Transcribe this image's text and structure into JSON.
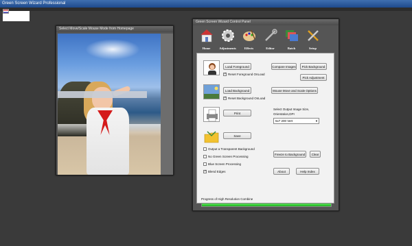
{
  "app": {
    "title": "Green Screen Wizard Professional"
  },
  "left_window": {
    "title": "Select Move/Scale Mouse Mode from Homepage"
  },
  "control_panel": {
    "title": "Green Screen Wizard Control Panel",
    "toolbar": [
      {
        "label": "Home",
        "icon": "house-icon"
      },
      {
        "label": "Adjustments",
        "icon": "gear-icon"
      },
      {
        "label": "Effects",
        "icon": "palette-icon"
      },
      {
        "label": "Editor",
        "icon": "wrench-icon"
      },
      {
        "label": "Batch",
        "icon": "stack-icon"
      },
      {
        "label": "Setup",
        "icon": "tools-icon"
      }
    ],
    "buttons": {
      "load_foreground": "Load Foreground",
      "compare_images": "Compare Images",
      "pick_background": "Pick Background",
      "pick_adjustment": "Pick Adjustment",
      "load_background": "Load Background",
      "mouse_move_scale": "Mouse Move and Scale Options",
      "print": "Print",
      "save": "Save",
      "freeze_to_background": "Freeze to Background",
      "clear": "Clear",
      "about": "About",
      "help_index": "Help Index"
    },
    "checkboxes": {
      "reset_foreground": {
        "label": "Reset Foreground OnLoad",
        "checked": true
      },
      "reset_background": {
        "label": "Reset Background OnLoad",
        "checked": true
      },
      "transparent_bg": {
        "label": "Output a Transparent Background",
        "checked": false
      },
      "no_green": {
        "label": "No Green Screen Processing",
        "checked": false
      },
      "blue_screen": {
        "label": "Blue Screen Processing",
        "checked": false
      },
      "blend_edges": {
        "label": "Blend Edges",
        "checked": true
      }
    },
    "output_size": {
      "label_line1": "Select Output Image Size,",
      "label_line2": "Orientation,DPI",
      "selected": "5x7 200 Vert"
    },
    "progress": {
      "label": "Progress of High Resolution Combine",
      "percent": 100
    }
  },
  "colors": {
    "progress_fill": "#1cb41c",
    "titlebar": "#1e4a8c"
  }
}
